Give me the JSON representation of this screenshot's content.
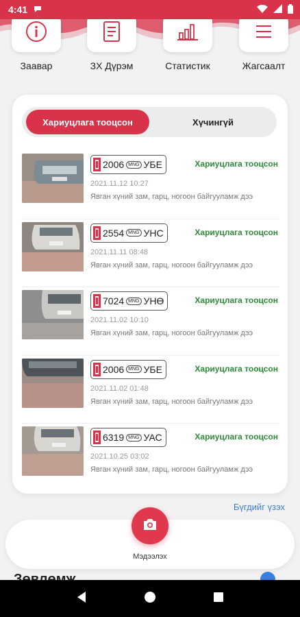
{
  "status_bar": {
    "time": "4:41"
  },
  "quick_actions": [
    {
      "label": "Заавар",
      "icon": "info-icon"
    },
    {
      "label": "ЗХ Дүрэм",
      "icon": "document-icon"
    },
    {
      "label": "Статистик",
      "icon": "bar-chart-icon"
    },
    {
      "label": "Жагсаалт",
      "icon": "list-icon"
    }
  ],
  "toggle": {
    "active": "Хариуцлага тооцсон",
    "inactive": "Хүчингүй"
  },
  "reports": [
    {
      "plate_number": "2006",
      "plate_country": "MNG",
      "plate_letters": "УБЕ",
      "status": "Хариуцлага тооцсон",
      "date": "2021.11.12 10:27",
      "description": "Явган хүний зам, гарц, ногоон байгууламж дээ"
    },
    {
      "plate_number": "2554",
      "plate_country": "MNG",
      "plate_letters": "УНС",
      "status": "Хариуцлага тооцсон",
      "date": "2021.11.11 08:48",
      "description": "Явган хүний зам, гарц, ногоон байгууламж дээ"
    },
    {
      "plate_number": "7024",
      "plate_country": "MNG",
      "plate_letters": "УНӨ",
      "status": "Хариуцлага тооцсон",
      "date": "2021.11.02 10:10",
      "description": "Явган хүний зам, гарц, ногоон байгууламж дээ"
    },
    {
      "plate_number": "2006",
      "plate_country": "MNG",
      "plate_letters": "УБЕ",
      "status": "Хариуцлага тооцсон",
      "date": "2021.11.02 01:48",
      "description": "Явган хүний зам, гарц, ногоон байгууламж дээ"
    },
    {
      "plate_number": "6319",
      "plate_country": "MNG",
      "plate_letters": "УАС",
      "status": "Хариуцлага тооцсон",
      "date": "2021.10.25 03:02",
      "description": "Явган хүний зам, гарц, ногоон байгууламж дээ"
    }
  ],
  "see_all": "Бүгдийг үзэх",
  "report_button": "Мэдээлэх",
  "tips_title": "Зөвлөмж",
  "colors": {
    "accent": "#d8334a",
    "success": "#2e8b3a",
    "link": "#3c7de0"
  }
}
